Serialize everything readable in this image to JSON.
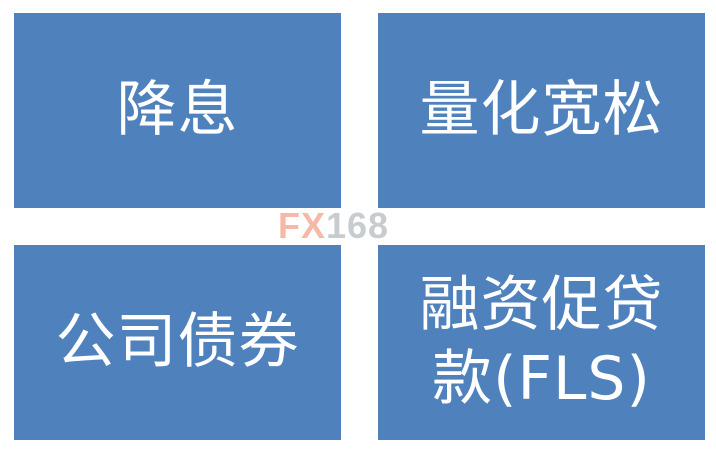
{
  "tiles": [
    {
      "label": "降息"
    },
    {
      "label": "量化宽松"
    },
    {
      "label": "公司债券"
    },
    {
      "label": "融资促贷\n款(FLS)"
    }
  ],
  "watermark": {
    "brand": "FX",
    "number": "168"
  },
  "colors": {
    "tile_fill": "#4f81bd",
    "tile_text": "#ffffff",
    "watermark_brand": "#f07f61",
    "watermark_number": "#9aa3ad"
  }
}
